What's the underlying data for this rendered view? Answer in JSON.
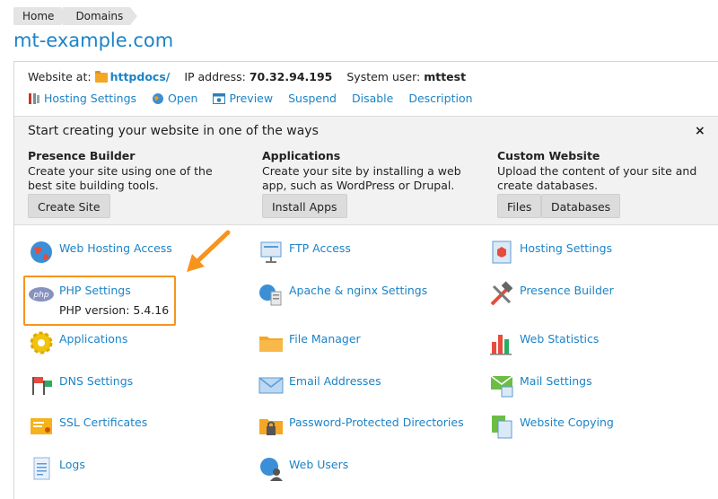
{
  "breadcrumb": [
    "Home",
    "Domains"
  ],
  "site_title": "mt-example.com",
  "info": {
    "website_at_label": "Website at:",
    "website_at_value": "httpdocs/",
    "ip_label": "IP address:",
    "ip_value": "70.32.94.195",
    "user_label": "System user:",
    "user_value": "mttest"
  },
  "actions": [
    "Hosting Settings",
    "Open",
    "Preview",
    "Suspend",
    "Disable",
    "Description"
  ],
  "start": {
    "title": "Start creating your website in one of the ways",
    "close": "×",
    "presence": {
      "heading": "Presence Builder",
      "text": "Create your site using one of the best site building tools.",
      "button": "Create Site"
    },
    "applications": {
      "heading": "Applications",
      "text": "Create your site by installing a web app, such as WordPress or Drupal.",
      "button": "Install Apps"
    },
    "custom": {
      "heading": "Custom Website",
      "text": "Upload the content of your site and create databases.",
      "button_files": "Files",
      "button_databases": "Databases"
    }
  },
  "tools": {
    "web_hosting_access": "Web Hosting Access",
    "ftp_access": "FTP Access",
    "hosting_settings": "Hosting Settings",
    "php_settings": "PHP Settings",
    "php_version": "PHP version: 5.4.16",
    "apache_nginx": "Apache & nginx Settings",
    "presence_builder": "Presence Builder",
    "applications": "Applications",
    "file_manager": "File Manager",
    "web_statistics": "Web Statistics",
    "dns_settings": "DNS Settings",
    "email_addresses": "Email Addresses",
    "mail_settings": "Mail Settings",
    "ssl_certificates": "SSL Certificates",
    "password_dirs": "Password-Protected Directories",
    "website_copying": "Website Copying",
    "logs": "Logs",
    "web_users": "Web Users"
  },
  "colors": {
    "link": "#1c83c7",
    "highlight": "#f7941d"
  }
}
